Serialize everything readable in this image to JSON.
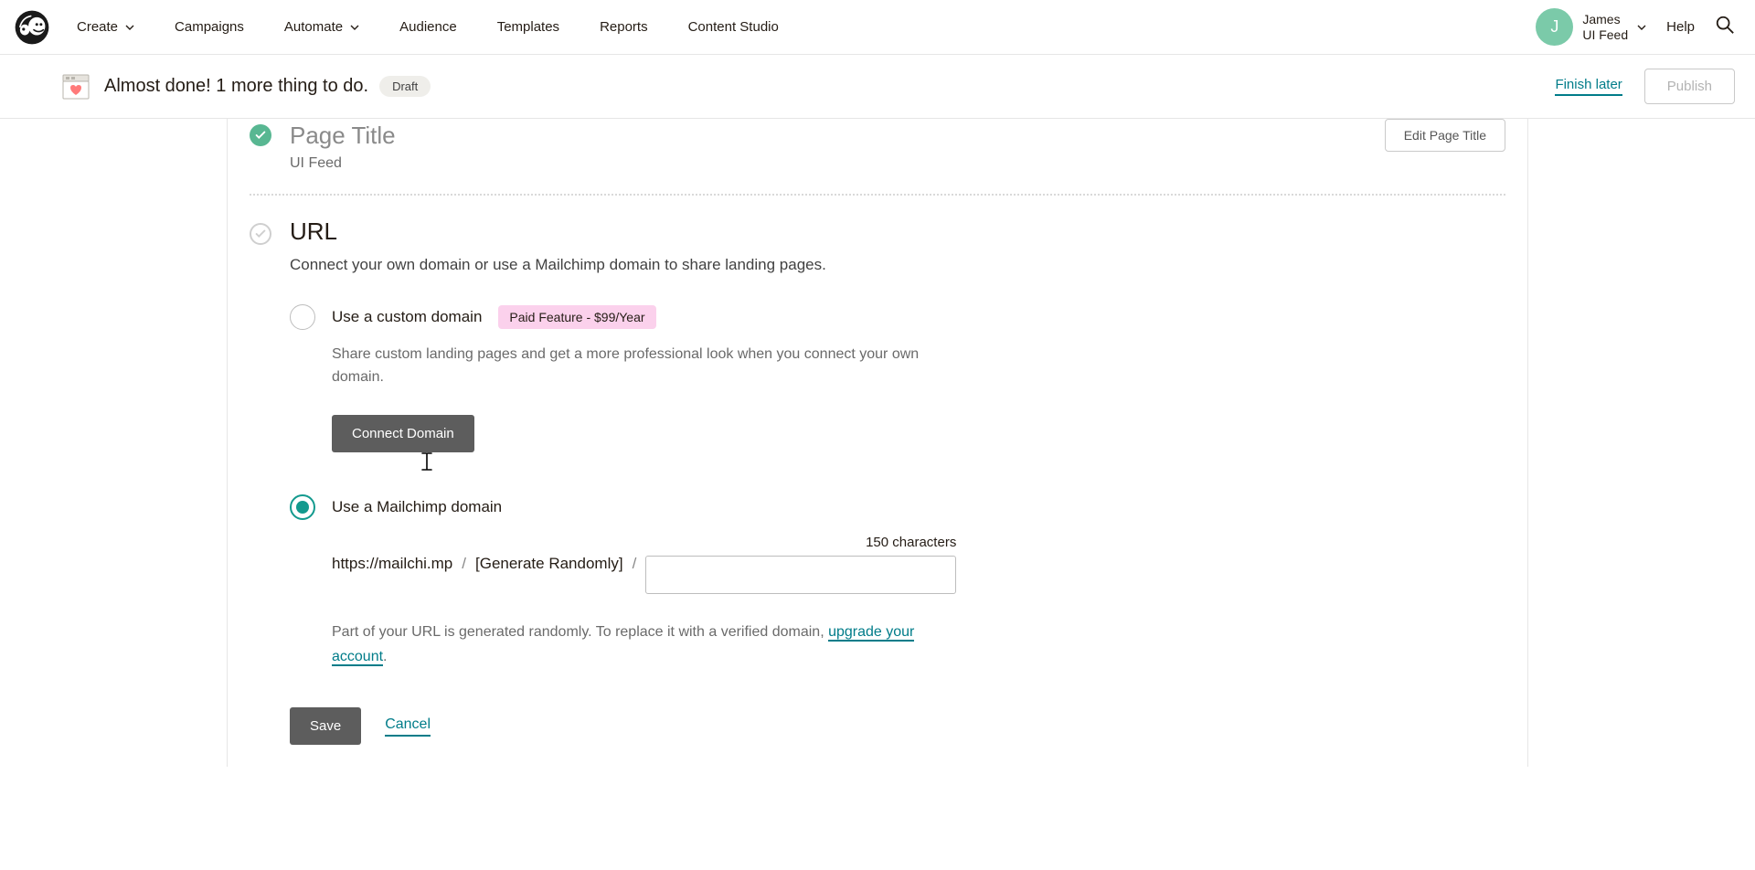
{
  "nav": {
    "items": [
      {
        "label": "Create",
        "caret": true
      },
      {
        "label": "Campaigns",
        "caret": false
      },
      {
        "label": "Automate",
        "caret": true
      },
      {
        "label": "Audience",
        "caret": false
      },
      {
        "label": "Templates",
        "caret": false
      },
      {
        "label": "Reports",
        "caret": false
      },
      {
        "label": "Content Studio",
        "caret": false
      }
    ],
    "user": {
      "initial": "J",
      "name": "James",
      "account": "UI Feed"
    },
    "help": "Help"
  },
  "subbar": {
    "title": "Almost done! 1 more thing to do.",
    "pill": "Draft",
    "finish": "Finish later",
    "publish": "Publish"
  },
  "page_title": {
    "heading": "Page Title",
    "value": "UI Feed",
    "edit": "Edit Page Title"
  },
  "url": {
    "heading": "URL",
    "desc": "Connect your own domain or use a Mailchimp domain to share landing pages.",
    "custom": {
      "label": "Use a custom domain",
      "badge": "Paid Feature - $99/Year",
      "desc": "Share custom landing pages and get a more professional look when you connect your own domain.",
      "button": "Connect Domain"
    },
    "mc": {
      "label": "Use a Mailchimp domain",
      "base": "https://mailchi.mp",
      "random": "[Generate Randomly]",
      "count": "150 characters",
      "input_value": ""
    },
    "notice_a": "Part of your URL is generated randomly. To replace it with a verified domain, ",
    "notice_link": "upgrade your account",
    "notice_b": "."
  },
  "actions": {
    "save": "Save",
    "cancel": "Cancel"
  }
}
